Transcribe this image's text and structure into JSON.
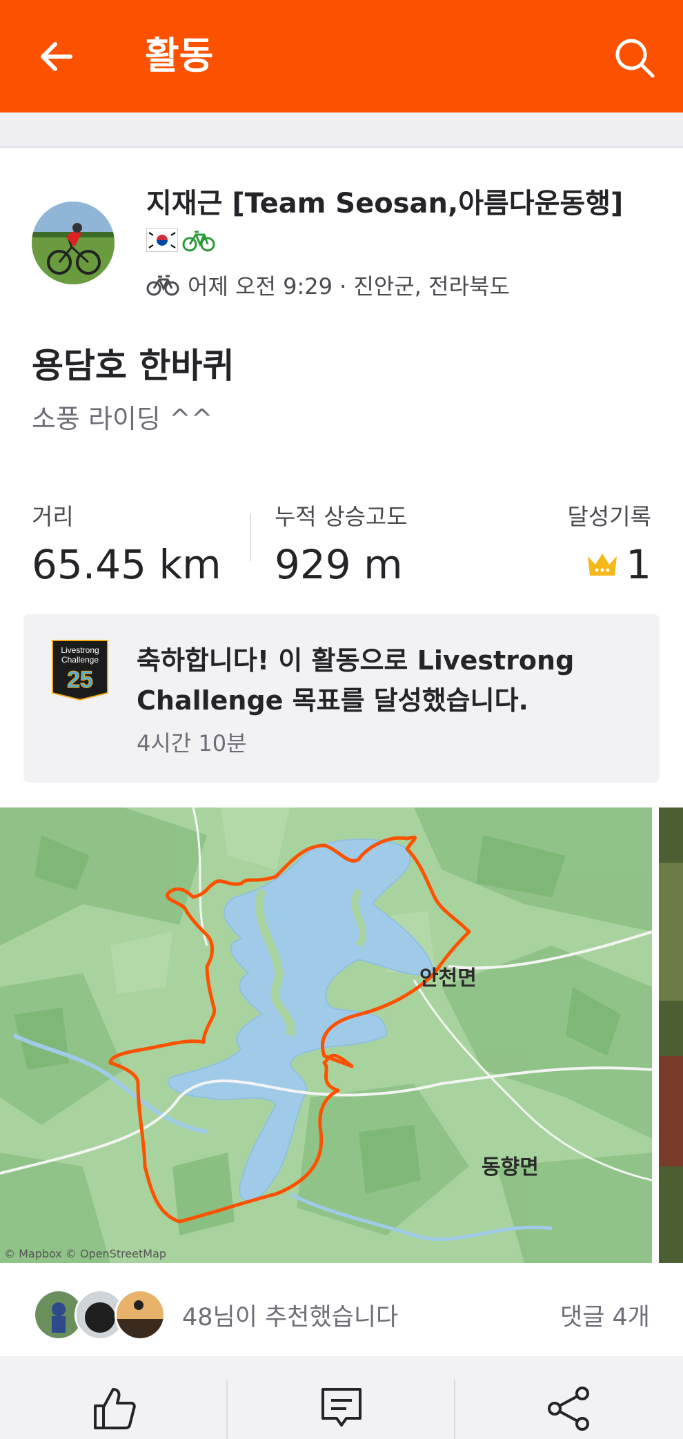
{
  "header": {
    "title": "활동",
    "back_icon": "back-arrow-icon",
    "search_icon": "search-icon",
    "background": "#fc5200"
  },
  "athlete": {
    "name": "지재근 [Team Seosan,아름다운동행]",
    "badges": [
      "korea-flag-icon",
      "bicycle-icon"
    ],
    "meta": "어제 오전 9:29 · 진안군, 전라북도",
    "sport_icon": "ride-icon"
  },
  "activity": {
    "title": "용담호 한바퀴",
    "description": "소풍 라이딩 ^^"
  },
  "stats": {
    "distance_label": "거리",
    "distance_value": "65.45 km",
    "elevation_label": "누적 상승고도",
    "elevation_value": "929 m",
    "achievements_label": "달성기록",
    "achievements_value": "1"
  },
  "achievement": {
    "badge_text_1": "Livestrong",
    "badge_text_2": "Challenge",
    "badge_number": "25",
    "message": "축하합니다! 이 활동으로 Livestrong Challenge 목표를 달성했습니다.",
    "time": "4시간 10분"
  },
  "map": {
    "labels": [
      "안천면",
      "동향면"
    ],
    "attribution": "© Mapbox © OpenStreetMap",
    "route_color": "#fc5200"
  },
  "social": {
    "kudos_text": "48님이 추천했습니다",
    "comments_text": "댓글 4개"
  },
  "actions": [
    "kudos-icon",
    "comment-icon",
    "share-icon"
  ]
}
